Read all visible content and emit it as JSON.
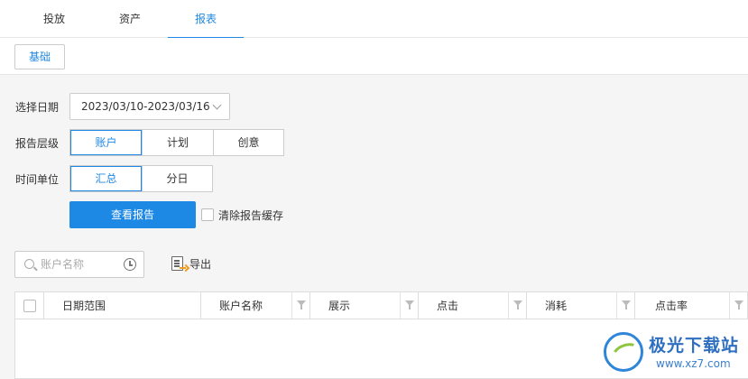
{
  "nav": {
    "tabs": [
      {
        "label": "投放"
      },
      {
        "label": "资产"
      },
      {
        "label": "报表"
      }
    ],
    "active_index": 2
  },
  "subnav": {
    "basic_button": "基础"
  },
  "filters": {
    "date": {
      "label": "选择日期",
      "value": "2023/03/10-2023/03/16"
    },
    "report_level": {
      "label": "报告层级",
      "options": [
        "账户",
        "计划",
        "创意"
      ],
      "selected": "账户"
    },
    "time_unit": {
      "label": "时间单位",
      "options": [
        "汇总",
        "分日"
      ],
      "selected": "汇总"
    },
    "view_report_button": "查看报告",
    "clear_cache_label": "清除报告缓存"
  },
  "toolbar": {
    "search_placeholder": "账户名称",
    "export_label": "导出"
  },
  "table": {
    "columns": [
      "日期范围",
      "账户名称",
      "展示",
      "点击",
      "消耗",
      "点击率"
    ]
  },
  "watermark": {
    "title": "极光下载站",
    "url": "www.xz7.com"
  },
  "colors": {
    "accent": "#1e88e5",
    "border": "#cccccc",
    "background": "#f5f5f5"
  }
}
